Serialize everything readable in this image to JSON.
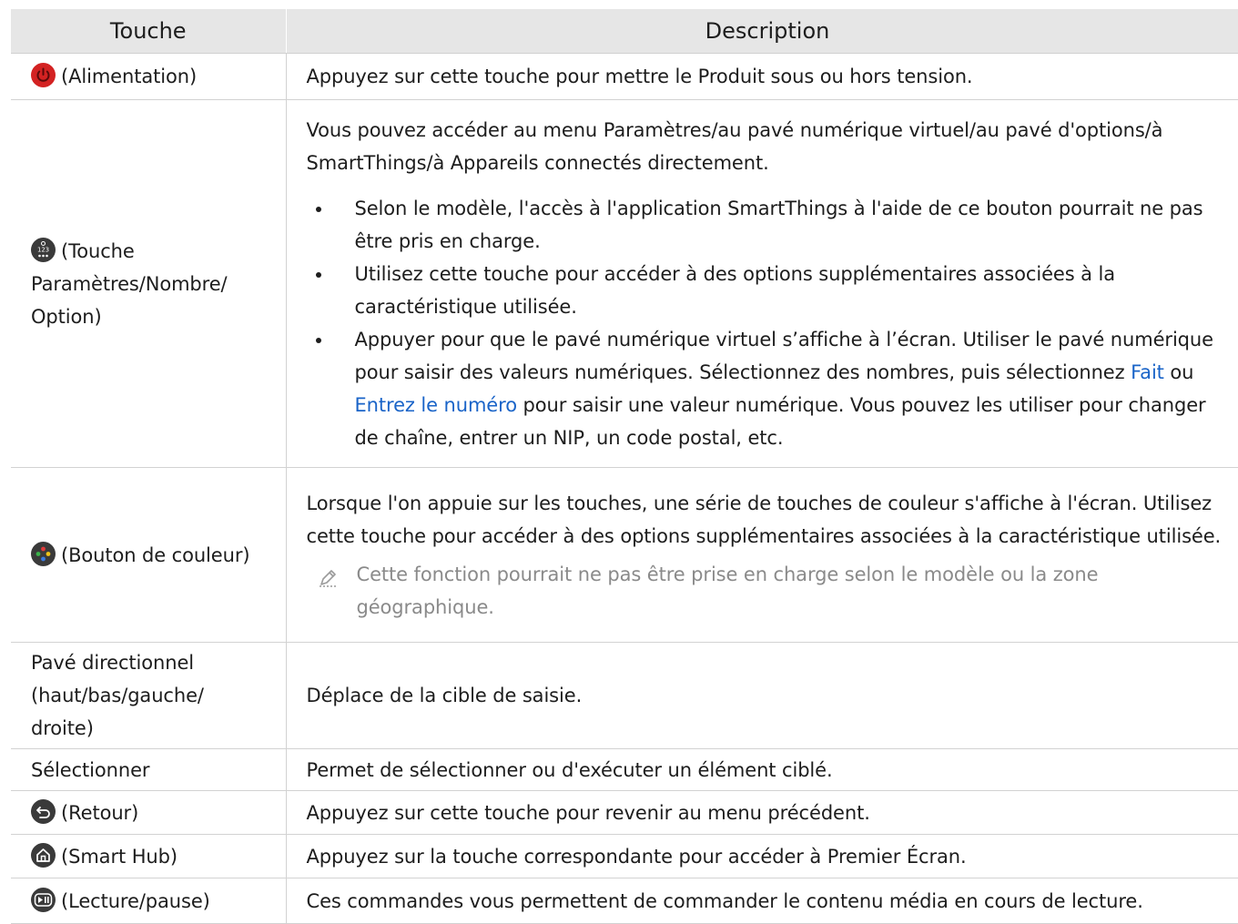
{
  "table": {
    "headers": [
      "Touche",
      "Description"
    ],
    "rows": {
      "power": {
        "key": "(Alimentation)",
        "desc": "Appuyez sur cette touche pour mettre le Produit sous ou hors tension."
      },
      "settings": {
        "key_line1": "(Touche",
        "key_line2": "Paramètres/Nombre/",
        "key_line3": "Option)",
        "intro_line1": "Vous pouvez accéder au menu Paramètres/au pavé numérique virtuel/au pavé d'options/à",
        "intro_line2": "SmartThings/à Appareils connectés directement.",
        "b1_line1": "Selon le modèle, l'accès à l'application SmartThings à l'aide de ce bouton pourrait ne pas",
        "b1_line2": "être pris en charge.",
        "b2_line1": "Utilisez cette touche pour accéder à des options supplémentaires associées à la",
        "b2_line2": "caractéristique utilisée.",
        "b3_line1": "Appuyer pour que le pavé numérique virtuel s’affiche à l’écran. Utiliser le pavé numérique",
        "b3_line2a": "pour saisir des valeurs numériques. Sélectionnez des nombres, puis sélectionnez ",
        "b3_link1": "Fait",
        "b3_line2b": " ou",
        "b3_link2": "Entrez le numéro",
        "b3_line3": " pour saisir une valeur numérique. Vous pouvez les utiliser pour changer",
        "b3_line4": "de chaîne, entrer un NIP, un code postal, etc."
      },
      "color": {
        "key": "(Bouton de couleur)",
        "desc_line1": "Lorsque l'on appuie sur les touches, une série de touches de couleur s'affiche à l'écran. Utilisez",
        "desc_line2": "cette touche pour accéder à des options supplémentaires associées à la caractéristique utilisée.",
        "note_line1": "Cette fonction pourrait ne pas être prise en charge selon le modèle ou la zone",
        "note_line2": "géographique."
      },
      "dpad": {
        "key_line1": "Pavé directionnel",
        "key_line2": "(haut/bas/gauche/",
        "key_line3": "droite)",
        "desc": "Déplace de la cible de saisie."
      },
      "select": {
        "key": "Sélectionner",
        "desc": "Permet de sélectionner ou d'exécuter un élément ciblé."
      },
      "back": {
        "key": "(Retour)",
        "desc": "Appuyez sur cette touche pour revenir au menu précédent."
      },
      "home": {
        "key": "(Smart Hub)",
        "desc": "Appuyez sur la touche correspondante pour accéder à Premier Écran."
      },
      "play": {
        "key": "(Lecture/pause)",
        "desc": "Ces commandes vous permettent de commander le contenu média en cours de lecture."
      }
    }
  },
  "icons": {
    "power": "power-icon",
    "settings": "settings-number-icon",
    "color": "color-button-icon",
    "back": "back-icon",
    "home": "home-icon",
    "play": "play-pause-icon",
    "note": "pencil-note-icon"
  },
  "colors": {
    "header_bg": "#e6e6e6",
    "link": "#1a64c8",
    "note_text": "#8a8a8a",
    "power_icon": "#d32222",
    "icon_dark": "#3a3a3a"
  }
}
